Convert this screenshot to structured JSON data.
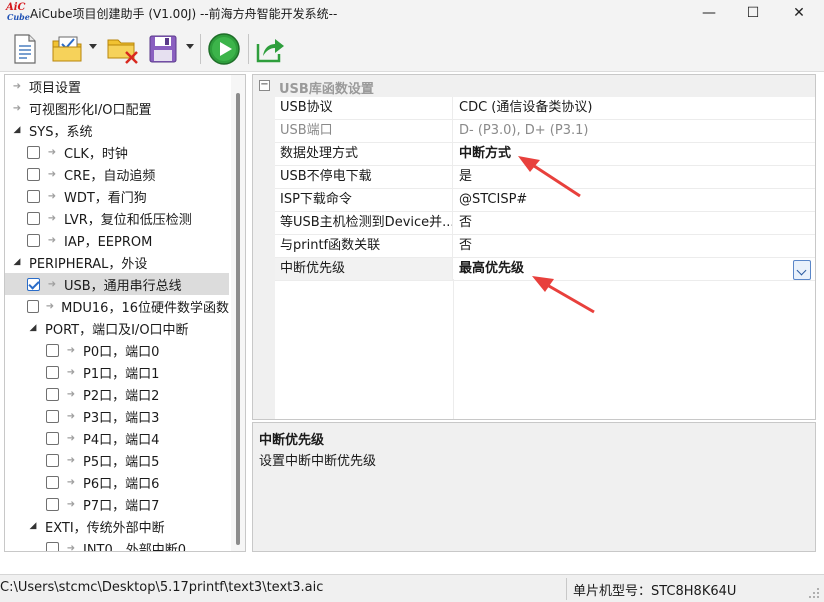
{
  "window": {
    "title": "AiCube项目创建助手 (V1.00J) --前海方舟智能开发系统--",
    "logo_top": "AiC",
    "logo_bottom": "Cube",
    "minimize": "—",
    "maximize": "☐",
    "close": "✕"
  },
  "toolbar": {
    "icons": [
      "new-file-icon",
      "open-project-icon",
      "close-project-icon",
      "save-icon",
      "run-icon",
      "export-icon"
    ]
  },
  "tree": {
    "items": [
      {
        "label": "项目设置",
        "kind": "arrow",
        "indent": 0
      },
      {
        "label": "可视图形化I/O口配置",
        "kind": "arrow",
        "indent": 0
      },
      {
        "label": "SYS，系统",
        "kind": "expand",
        "indent": 0
      },
      {
        "label": "CLK，时钟",
        "kind": "check",
        "indent": 1,
        "checked": false
      },
      {
        "label": "CRE，自动追频",
        "kind": "check",
        "indent": 1,
        "checked": false
      },
      {
        "label": "WDT，看门狗",
        "kind": "check",
        "indent": 1,
        "checked": false
      },
      {
        "label": "LVR，复位和低压检测",
        "kind": "check",
        "indent": 1,
        "checked": false
      },
      {
        "label": "IAP，EEPROM",
        "kind": "check",
        "indent": 1,
        "checked": false
      },
      {
        "label": "PERIPHERAL，外设",
        "kind": "expand",
        "indent": 0
      },
      {
        "label": "USB，通用串行总线",
        "kind": "check",
        "indent": 1,
        "checked": true,
        "selected": true
      },
      {
        "label": "MDU16，16位硬件数学函数",
        "kind": "check",
        "indent": 1,
        "checked": false
      },
      {
        "label": "PORT，端口及I/O口中断",
        "kind": "expand",
        "indent": 1
      },
      {
        "label": "P0口，端口0",
        "kind": "check",
        "indent": 2,
        "checked": false
      },
      {
        "label": "P1口，端口1",
        "kind": "check",
        "indent": 2,
        "checked": false
      },
      {
        "label": "P2口，端口2",
        "kind": "check",
        "indent": 2,
        "checked": false
      },
      {
        "label": "P3口，端口3",
        "kind": "check",
        "indent": 2,
        "checked": false
      },
      {
        "label": "P4口，端口4",
        "kind": "check",
        "indent": 2,
        "checked": false
      },
      {
        "label": "P5口，端口5",
        "kind": "check",
        "indent": 2,
        "checked": false
      },
      {
        "label": "P6口，端口6",
        "kind": "check",
        "indent": 2,
        "checked": false
      },
      {
        "label": "P7口，端口7",
        "kind": "check",
        "indent": 2,
        "checked": false
      },
      {
        "label": "EXTI，传统外部中断",
        "kind": "expand",
        "indent": 1
      },
      {
        "label": "INT0，外部中断0",
        "kind": "check",
        "indent": 2,
        "checked": false
      }
    ]
  },
  "properties": {
    "category": "USB库函数设置",
    "category_toggle": "−",
    "rows": [
      {
        "name": "USB协议",
        "value": "CDC (通信设备类协议)"
      },
      {
        "name": "USB端口",
        "value": "D- (P3.0), D+ (P3.1)",
        "dim": true
      },
      {
        "name": "数据处理方式",
        "value": "中断方式",
        "bold": true
      },
      {
        "name": "USB不停电下载",
        "value": "是"
      },
      {
        "name": "ISP下载命令",
        "value": "@STCISP#"
      },
      {
        "name": "等USB主机检测到Device并...",
        "value": "否"
      },
      {
        "name": "与printf函数关联",
        "value": "否"
      },
      {
        "name": "中断优先级",
        "value": "最高优先级",
        "bold": true,
        "selected": true
      }
    ]
  },
  "description": {
    "title": "中断优先级",
    "text": "设置中断中断优先级"
  },
  "status": {
    "path": "C:\\Users\\stcmc\\Desktop\\5.17printf\\text3\\text3.aic",
    "chip": "单片机型号：STC8H8K64U"
  },
  "colors": {
    "accent": "#2a6cc8",
    "annotation_arrow": "#e8403c",
    "run_green": "#2e9e3c"
  }
}
